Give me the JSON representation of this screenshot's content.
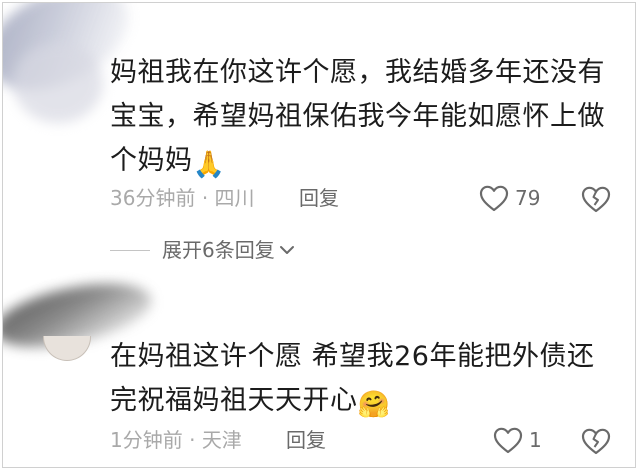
{
  "comments": [
    {
      "text": "妈祖我在你这许个愿，我结婚多年还没有宝宝，希望妈祖保佑我今年能如愿怀上做个妈妈",
      "emoji": "🙏",
      "time": "36分钟前",
      "separator": "·",
      "location": "四川",
      "reply_label": "回复",
      "likes": "79",
      "expand_label": "展开6条回复"
    },
    {
      "text": "在妈祖这许个愿 希望我26年能把外债还完祝福妈祖天天开心",
      "emoji": "🤗",
      "time": "1分钟前",
      "separator": "·",
      "location": "天津",
      "reply_label": "回复",
      "likes": "1"
    }
  ],
  "icons": {
    "like": "heart-outline-icon",
    "dislike": "broken-heart-outline-icon",
    "expand": "chevron-down-icon"
  },
  "colors": {
    "text": "#1c1c1c",
    "meta": "#a9a9a9",
    "action": "#6a6a6a"
  }
}
